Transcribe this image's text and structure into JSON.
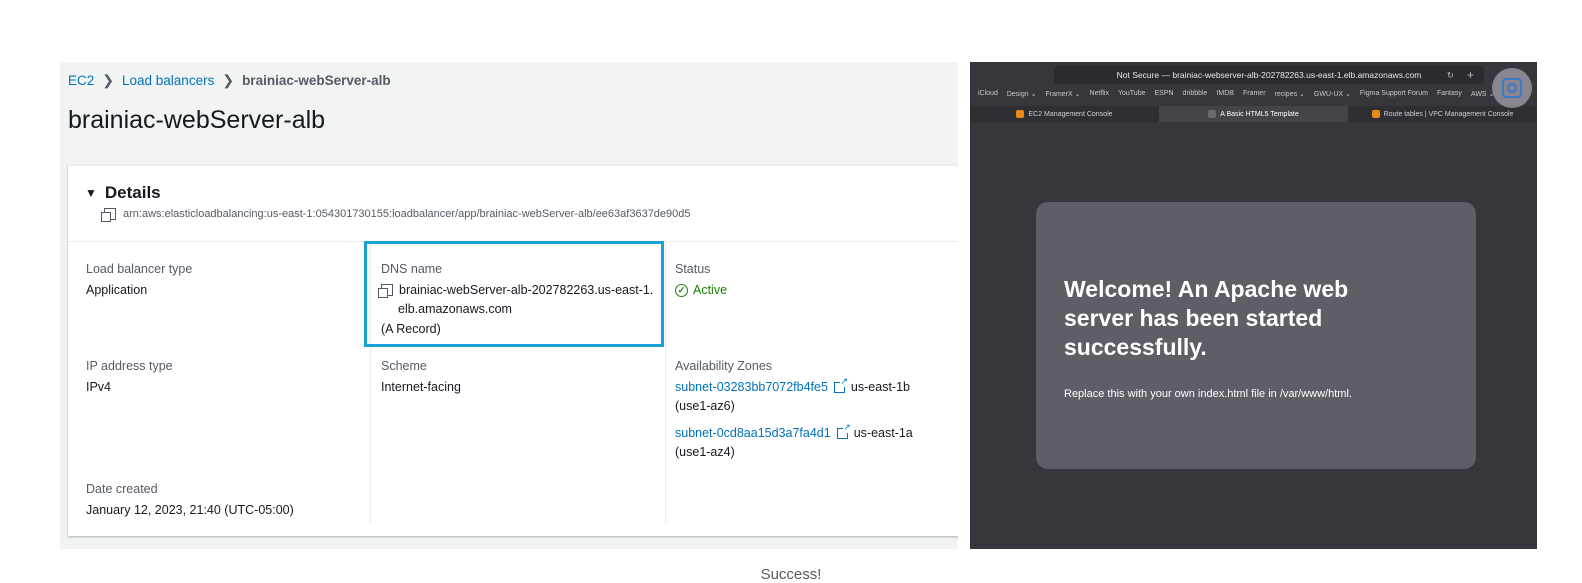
{
  "console": {
    "breadcrumb": [
      "EC2",
      "Load balancers",
      "brainiac-webServer-alb"
    ],
    "title": "brainiac-webServer-alb",
    "details_heading": "Details",
    "arn": "arn:aws:elasticloadbalancing:us-east-1:054301730155:loadbalancer/app/brainiac-webServer-alb/ee63af3637de90d5",
    "lb_type_label": "Load balancer type",
    "lb_type_value": "Application",
    "dns_label": "DNS name",
    "dns_value_line1": "brainiac-webServer-alb-202782263.us-east-1.",
    "dns_value_line2": "elb.amazonaws.com",
    "dns_record": "(A Record)",
    "status_label": "Status",
    "status_value": "Active",
    "ip_label": "IP address type",
    "ip_value": "IPv4",
    "scheme_label": "Scheme",
    "scheme_value": "Internet-facing",
    "az_label": "Availability Zones",
    "az": [
      {
        "subnet": "subnet-03283bb7072fb4fe5",
        "zone": "us-east-1b",
        "id": "(use1-az6)"
      },
      {
        "subnet": "subnet-0cd8aa15d3a7fa4d1",
        "zone": "us-east-1a",
        "id": "(use1-az4)"
      }
    ],
    "date_label": "Date created",
    "date_value": "January 12, 2023, 21:40 (UTC-05:00)"
  },
  "browser": {
    "url": "Not Secure — brainiac-webserver-alb-202782263.us-east-1.elb.amazonaws.com",
    "bookmarks": [
      "iCloud",
      "Design ⌄",
      "FramerX ⌄",
      "Netflix",
      "YouTube",
      "ESPN",
      "dribbble",
      "IMDB",
      "Framer",
      "recipes ⌄",
      "GWU-UX ⌄",
      "Figma Support Forum",
      "Fantasy",
      "AWS ⌄"
    ],
    "tabs": [
      "EC2 Management Console",
      "A Basic HTML5 Template",
      "Route tables | VPC Management Console"
    ],
    "welcome_title": "Welcome! An Apache web server has been started successfully.",
    "welcome_text": "Replace this with your own index.html file in /var/www/html."
  },
  "caption": "Success!"
}
